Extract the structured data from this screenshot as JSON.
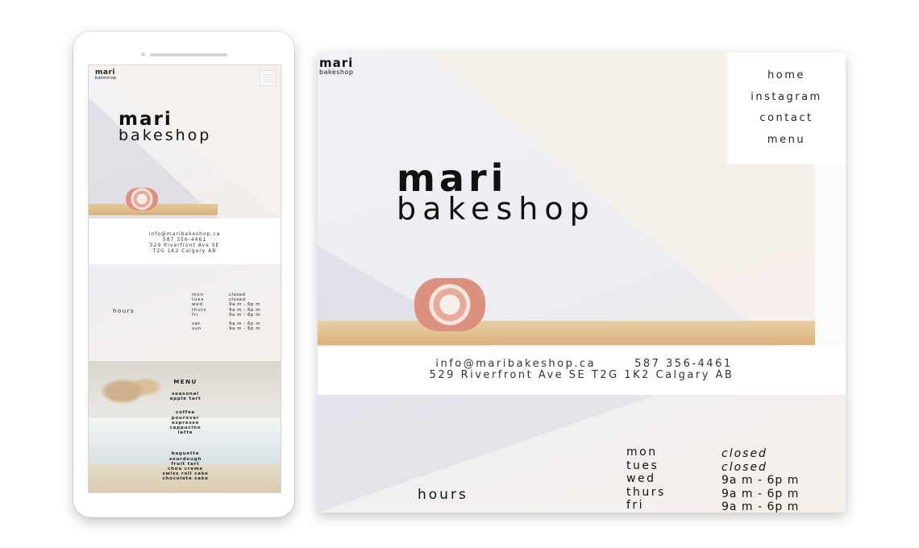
{
  "brand": {
    "name": "mari",
    "sub": "bakeshop"
  },
  "nav": {
    "items": [
      "home",
      "instagram",
      "contact",
      "menu"
    ]
  },
  "contact": {
    "email": "info@maribakeshop.ca",
    "phone": "587 356-4461",
    "address": "529 Riverfront Ave  SE T2G  1K2 Calgary AB",
    "address_line1": "529 Riverfront Ave  SE",
    "address_line2": "T2G 1K2 Calgary AB"
  },
  "hours": {
    "title": "hours",
    "rows": [
      {
        "day": "mon",
        "time": "closed"
      },
      {
        "day": "tues",
        "time": "closed"
      },
      {
        "day": "wed",
        "time": "9a m - 6p m"
      },
      {
        "day": "thurs",
        "time": "9a m - 6p m"
      },
      {
        "day": "fri",
        "time": "9a m - 6p m"
      },
      {
        "day": "sat",
        "time": "9a m - 6p m"
      },
      {
        "day": "sun",
        "time": "9a m - 6p m"
      }
    ]
  },
  "menu": {
    "title": "MENU",
    "groups": [
      [
        "seasonal",
        "apple tart"
      ],
      [
        "coffee",
        "pourover",
        "espresso",
        "cappucino",
        "latte"
      ],
      [
        "baguette",
        "sourdough",
        "fruit tart",
        "chou creme",
        "swiss roll cake",
        "chocolate cake"
      ]
    ]
  },
  "colors": {
    "text": "#222222",
    "wood": "#d8b37c",
    "cake": "#e6a99a",
    "background": "#efeef3"
  }
}
